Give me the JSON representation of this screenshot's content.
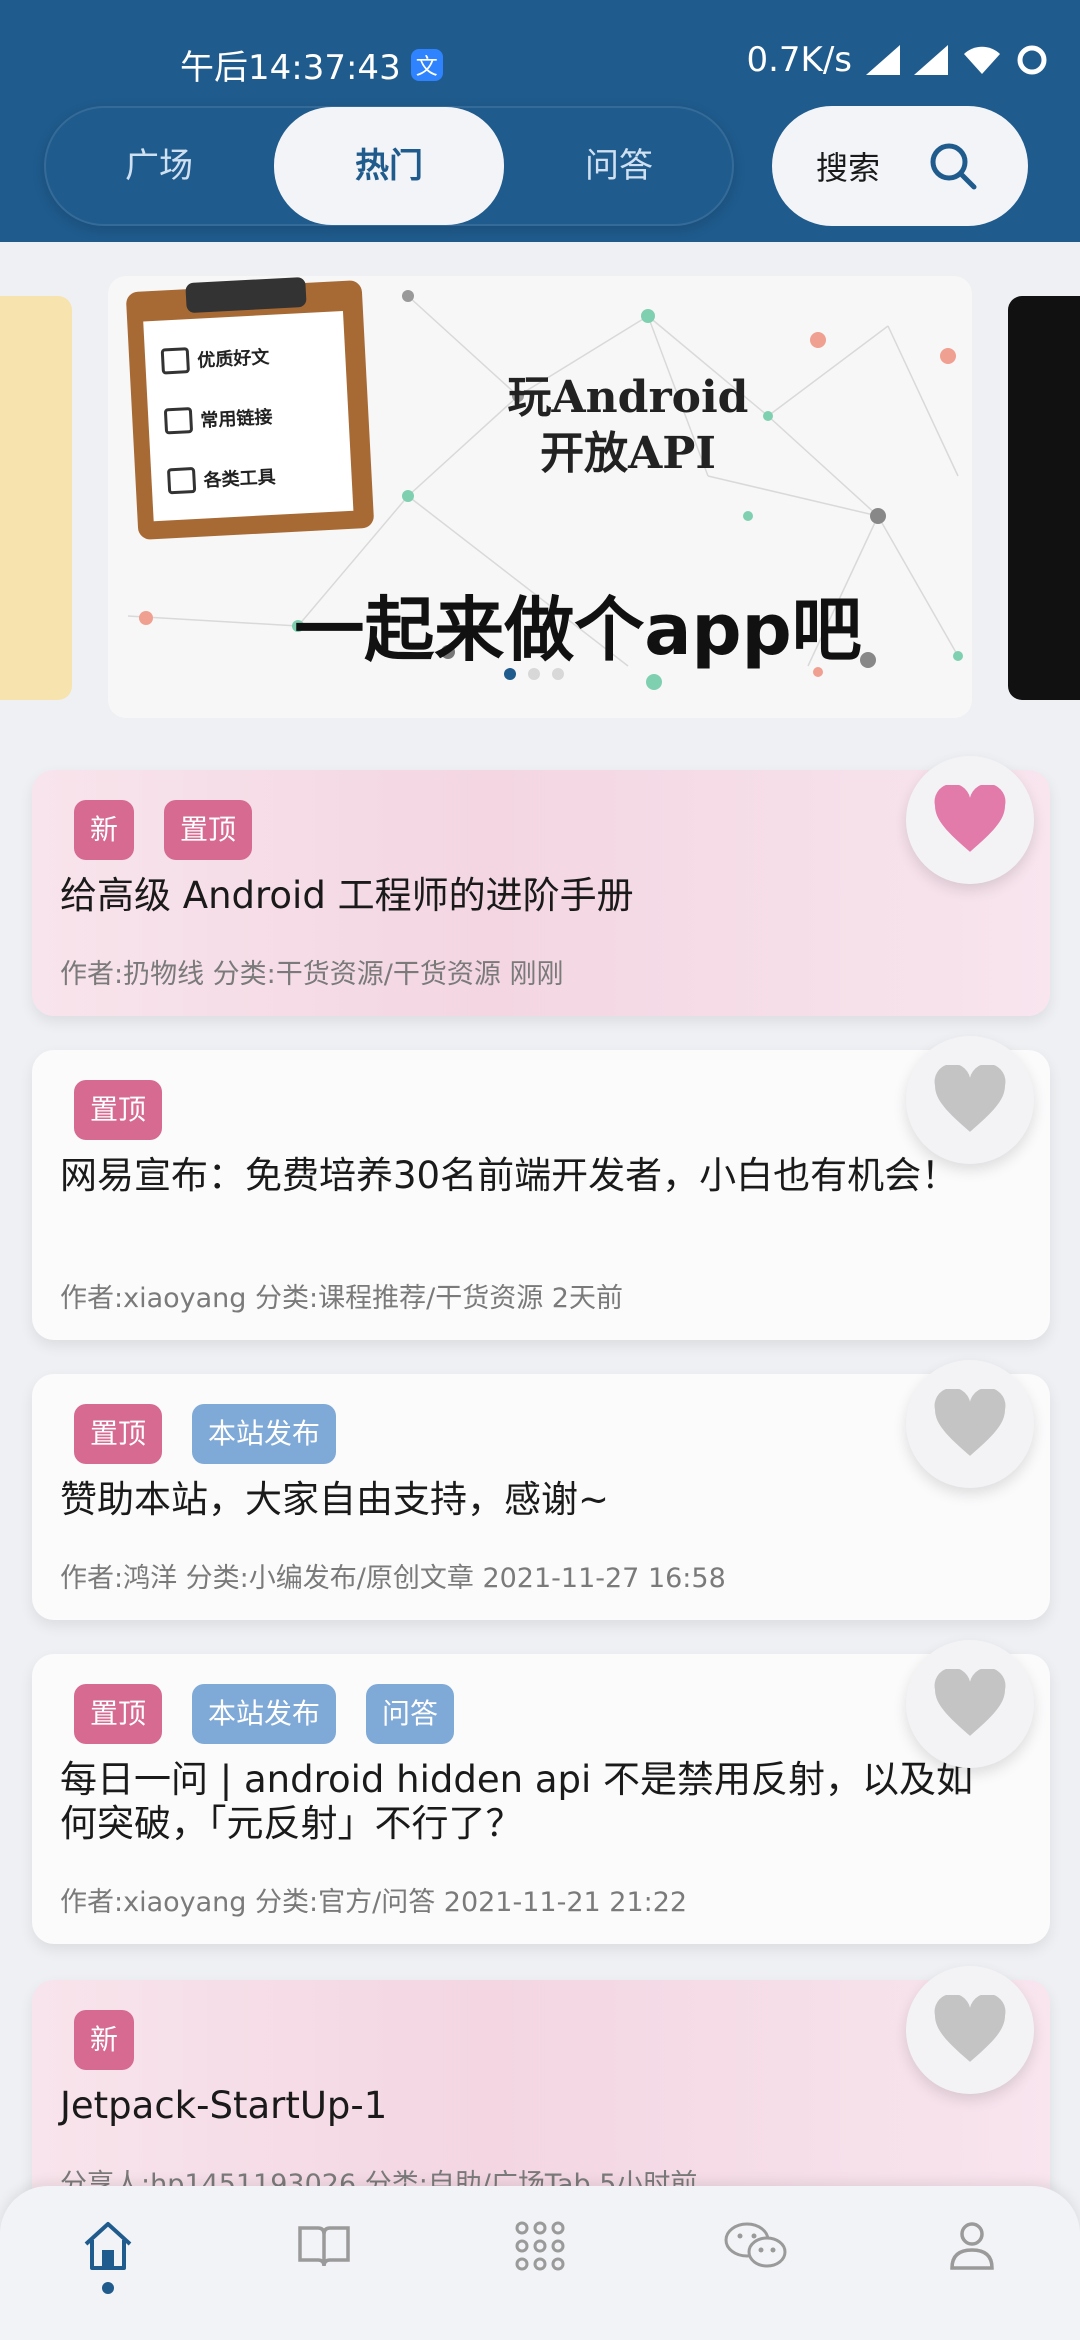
{
  "status_bar": {
    "time": "午后14:37:43",
    "app_icon_label": "文",
    "speed": "0.7K/s"
  },
  "tabs": [
    {
      "label": "广场",
      "active": false
    },
    {
      "label": "热门",
      "active": true
    },
    {
      "label": "问答",
      "active": false
    }
  ],
  "search": {
    "label": "搜索",
    "icon": "search-icon"
  },
  "banner": {
    "title_line1": "玩Android",
    "title_line2": "开放API",
    "slogan": "一起来做个app吧",
    "checklist": [
      "优质好文",
      "常用链接",
      "各类工具"
    ],
    "current_index": 0,
    "count": 3
  },
  "articles": [
    {
      "tags": [
        {
          "text": "新",
          "color": "red"
        },
        {
          "text": "置顶",
          "color": "red"
        }
      ],
      "title": "给高级 Android 工程师的进阶手册",
      "meta": "作者:扔物线  分类:干货资源/干货资源  刚刚",
      "favorited": true,
      "highlight": true
    },
    {
      "tags": [
        {
          "text": "置顶",
          "color": "red"
        }
      ],
      "title": "网易宣布：免费培养30名前端开发者，小白也有机会！",
      "meta": "作者:xiaoyang  分类:课程推荐/干货资源  2天前",
      "favorited": false,
      "highlight": false
    },
    {
      "tags": [
        {
          "text": "置顶",
          "color": "red"
        },
        {
          "text": "本站发布",
          "color": "blue"
        }
      ],
      "title": "赞助本站，大家自由支持，感谢~",
      "meta": "作者:鸿洋  分类:小编发布/原创文章  2021-11-27 16:58",
      "favorited": false,
      "highlight": false
    },
    {
      "tags": [
        {
          "text": "置顶",
          "color": "red"
        },
        {
          "text": "本站发布",
          "color": "blue"
        },
        {
          "text": "问答",
          "color": "blue"
        }
      ],
      "title": "每日一问 | android hidden api 不是禁用反射，以及如何突破，「元反射」不行了？",
      "meta": "作者:xiaoyang  分类:官方/问答  2021-11-21 21:22",
      "favorited": false,
      "highlight": false
    },
    {
      "tags": [
        {
          "text": "新",
          "color": "red"
        }
      ],
      "title": "Jetpack-StartUp-1",
      "meta": "分享人:hp1451193026  分类:自助/广场Tab  5小时前",
      "favorited": false,
      "highlight": true
    }
  ],
  "bottom_nav": [
    {
      "icon": "home-icon",
      "active": true
    },
    {
      "icon": "book-icon",
      "active": false
    },
    {
      "icon": "grid-icon",
      "active": false
    },
    {
      "icon": "wechat-icon",
      "active": false
    },
    {
      "icon": "profile-icon",
      "active": false
    }
  ],
  "colors": {
    "primary": "#1f5b8d",
    "tag_red": "#d66a91",
    "tag_blue": "#7fa9d6",
    "heart_active": "#e27aaa",
    "heart_inactive": "#c4c4c4"
  }
}
